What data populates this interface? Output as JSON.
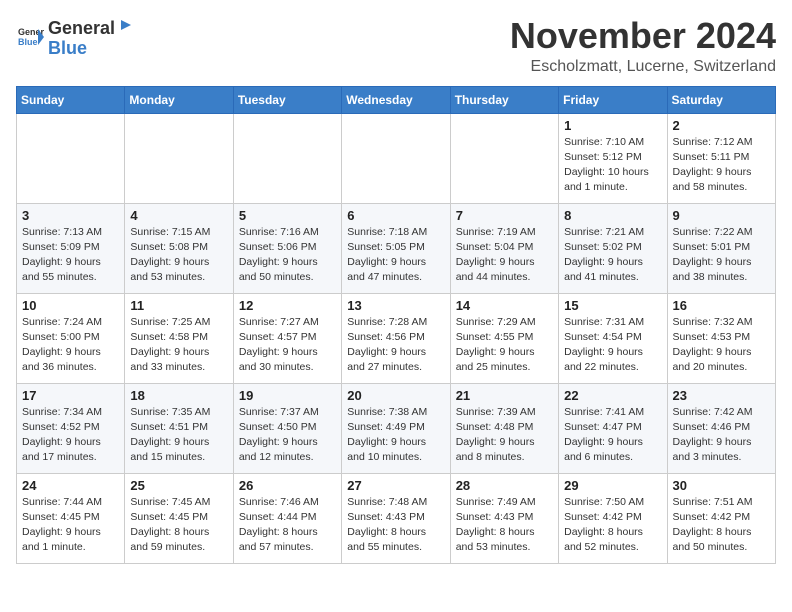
{
  "header": {
    "logo_general": "General",
    "logo_blue": "Blue",
    "month_title": "November 2024",
    "location": "Escholzmatt, Lucerne, Switzerland"
  },
  "weekdays": [
    "Sunday",
    "Monday",
    "Tuesday",
    "Wednesday",
    "Thursday",
    "Friday",
    "Saturday"
  ],
  "weeks": [
    [
      {
        "day": "",
        "info": ""
      },
      {
        "day": "",
        "info": ""
      },
      {
        "day": "",
        "info": ""
      },
      {
        "day": "",
        "info": ""
      },
      {
        "day": "",
        "info": ""
      },
      {
        "day": "1",
        "info": "Sunrise: 7:10 AM\nSunset: 5:12 PM\nDaylight: 10 hours\nand 1 minute."
      },
      {
        "day": "2",
        "info": "Sunrise: 7:12 AM\nSunset: 5:11 PM\nDaylight: 9 hours\nand 58 minutes."
      }
    ],
    [
      {
        "day": "3",
        "info": "Sunrise: 7:13 AM\nSunset: 5:09 PM\nDaylight: 9 hours\nand 55 minutes."
      },
      {
        "day": "4",
        "info": "Sunrise: 7:15 AM\nSunset: 5:08 PM\nDaylight: 9 hours\nand 53 minutes."
      },
      {
        "day": "5",
        "info": "Sunrise: 7:16 AM\nSunset: 5:06 PM\nDaylight: 9 hours\nand 50 minutes."
      },
      {
        "day": "6",
        "info": "Sunrise: 7:18 AM\nSunset: 5:05 PM\nDaylight: 9 hours\nand 47 minutes."
      },
      {
        "day": "7",
        "info": "Sunrise: 7:19 AM\nSunset: 5:04 PM\nDaylight: 9 hours\nand 44 minutes."
      },
      {
        "day": "8",
        "info": "Sunrise: 7:21 AM\nSunset: 5:02 PM\nDaylight: 9 hours\nand 41 minutes."
      },
      {
        "day": "9",
        "info": "Sunrise: 7:22 AM\nSunset: 5:01 PM\nDaylight: 9 hours\nand 38 minutes."
      }
    ],
    [
      {
        "day": "10",
        "info": "Sunrise: 7:24 AM\nSunset: 5:00 PM\nDaylight: 9 hours\nand 36 minutes."
      },
      {
        "day": "11",
        "info": "Sunrise: 7:25 AM\nSunset: 4:58 PM\nDaylight: 9 hours\nand 33 minutes."
      },
      {
        "day": "12",
        "info": "Sunrise: 7:27 AM\nSunset: 4:57 PM\nDaylight: 9 hours\nand 30 minutes."
      },
      {
        "day": "13",
        "info": "Sunrise: 7:28 AM\nSunset: 4:56 PM\nDaylight: 9 hours\nand 27 minutes."
      },
      {
        "day": "14",
        "info": "Sunrise: 7:29 AM\nSunset: 4:55 PM\nDaylight: 9 hours\nand 25 minutes."
      },
      {
        "day": "15",
        "info": "Sunrise: 7:31 AM\nSunset: 4:54 PM\nDaylight: 9 hours\nand 22 minutes."
      },
      {
        "day": "16",
        "info": "Sunrise: 7:32 AM\nSunset: 4:53 PM\nDaylight: 9 hours\nand 20 minutes."
      }
    ],
    [
      {
        "day": "17",
        "info": "Sunrise: 7:34 AM\nSunset: 4:52 PM\nDaylight: 9 hours\nand 17 minutes."
      },
      {
        "day": "18",
        "info": "Sunrise: 7:35 AM\nSunset: 4:51 PM\nDaylight: 9 hours\nand 15 minutes."
      },
      {
        "day": "19",
        "info": "Sunrise: 7:37 AM\nSunset: 4:50 PM\nDaylight: 9 hours\nand 12 minutes."
      },
      {
        "day": "20",
        "info": "Sunrise: 7:38 AM\nSunset: 4:49 PM\nDaylight: 9 hours\nand 10 minutes."
      },
      {
        "day": "21",
        "info": "Sunrise: 7:39 AM\nSunset: 4:48 PM\nDaylight: 9 hours\nand 8 minutes."
      },
      {
        "day": "22",
        "info": "Sunrise: 7:41 AM\nSunset: 4:47 PM\nDaylight: 9 hours\nand 6 minutes."
      },
      {
        "day": "23",
        "info": "Sunrise: 7:42 AM\nSunset: 4:46 PM\nDaylight: 9 hours\nand 3 minutes."
      }
    ],
    [
      {
        "day": "24",
        "info": "Sunrise: 7:44 AM\nSunset: 4:45 PM\nDaylight: 9 hours\nand 1 minute."
      },
      {
        "day": "25",
        "info": "Sunrise: 7:45 AM\nSunset: 4:45 PM\nDaylight: 8 hours\nand 59 minutes."
      },
      {
        "day": "26",
        "info": "Sunrise: 7:46 AM\nSunset: 4:44 PM\nDaylight: 8 hours\nand 57 minutes."
      },
      {
        "day": "27",
        "info": "Sunrise: 7:48 AM\nSunset: 4:43 PM\nDaylight: 8 hours\nand 55 minutes."
      },
      {
        "day": "28",
        "info": "Sunrise: 7:49 AM\nSunset: 4:43 PM\nDaylight: 8 hours\nand 53 minutes."
      },
      {
        "day": "29",
        "info": "Sunrise: 7:50 AM\nSunset: 4:42 PM\nDaylight: 8 hours\nand 52 minutes."
      },
      {
        "day": "30",
        "info": "Sunrise: 7:51 AM\nSunset: 4:42 PM\nDaylight: 8 hours\nand 50 minutes."
      }
    ]
  ]
}
